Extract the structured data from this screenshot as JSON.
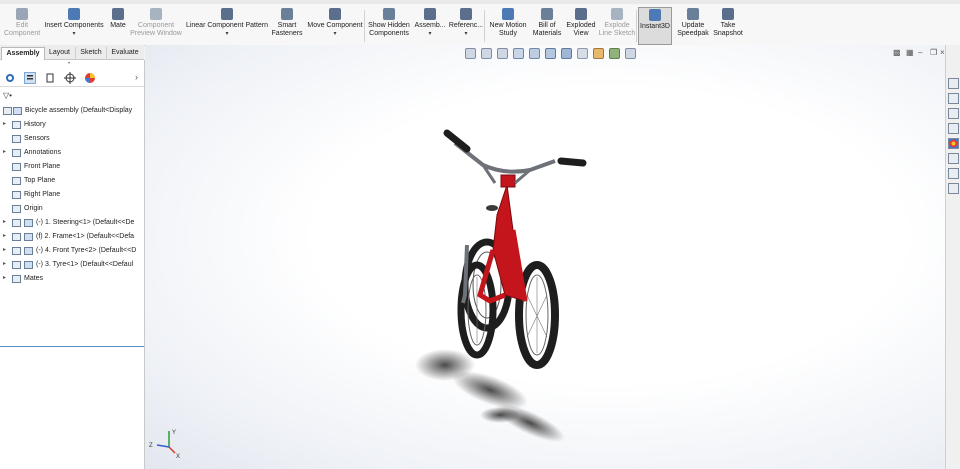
{
  "ribbon": {
    "items": [
      {
        "label1": "Edit",
        "label2": "Component",
        "state": "disabled"
      },
      {
        "label1": "Insert Components",
        "label2": "",
        "state": "normal"
      },
      {
        "label1": "Mate",
        "label2": "",
        "state": "normal"
      },
      {
        "label1": "Component",
        "label2": "Preview Window",
        "state": "disabled"
      },
      {
        "label1": "Linear Component Pattern",
        "label2": "",
        "state": "normal"
      },
      {
        "label1": "Smart",
        "label2": "Fasteners",
        "state": "normal"
      },
      {
        "label1": "Move Component",
        "label2": "",
        "state": "normal"
      },
      {
        "label1": "Show Hidden",
        "label2": "Components",
        "state": "normal"
      },
      {
        "label1": "Assemb...",
        "label2": "",
        "state": "normal"
      },
      {
        "label1": "Referenc...",
        "label2": "",
        "state": "normal"
      },
      {
        "label1": "New Motion",
        "label2": "Study",
        "state": "normal"
      },
      {
        "label1": "Bill of",
        "label2": "Materials",
        "state": "normal"
      },
      {
        "label1": "Exploded",
        "label2": "View",
        "state": "normal"
      },
      {
        "label1": "Explode",
        "label2": "Line Sketch",
        "state": "disabled"
      },
      {
        "label1": "Instant3D",
        "label2": "",
        "state": "active"
      },
      {
        "label1": "Update",
        "label2": "Speedpak",
        "state": "normal"
      },
      {
        "label1": "Take",
        "label2": "Snapshot",
        "state": "normal"
      }
    ]
  },
  "tabs": [
    "Assembly",
    "Layout",
    "Sketch",
    "Evaluate"
  ],
  "tree": {
    "filter_symbol": "▽•",
    "nodes": [
      {
        "label": "Bicycle assembly  (Default<Display",
        "expander": ""
      },
      {
        "label": "History",
        "expander": "▸"
      },
      {
        "label": "Sensors",
        "expander": ""
      },
      {
        "label": "Annotations",
        "expander": "▸"
      },
      {
        "label": "Front Plane",
        "expander": ""
      },
      {
        "label": "Top Plane",
        "expander": ""
      },
      {
        "label": "Right Plane",
        "expander": ""
      },
      {
        "label": "Origin",
        "expander": ""
      },
      {
        "label": "(-) 1. Steering<1> (Default<<De",
        "expander": "▸"
      },
      {
        "label": "(f) 2. Frame<1> (Default<<Defa",
        "expander": "▸"
      },
      {
        "label": "(-) 4. Front Tyre<2> (Default<<D",
        "expander": "▸"
      },
      {
        "label": "(-) 3. Tyre<1> (Default<<Defaul",
        "expander": "▸"
      },
      {
        "label": "Mates",
        "expander": "▸"
      }
    ]
  },
  "triad": {
    "x": "X",
    "y": "Y",
    "z": "Z"
  },
  "colors": {
    "frame": "#c4141c",
    "tyre": "#1e1e1e",
    "handlebar": "#6e7278",
    "accent": "#2f6db5"
  }
}
